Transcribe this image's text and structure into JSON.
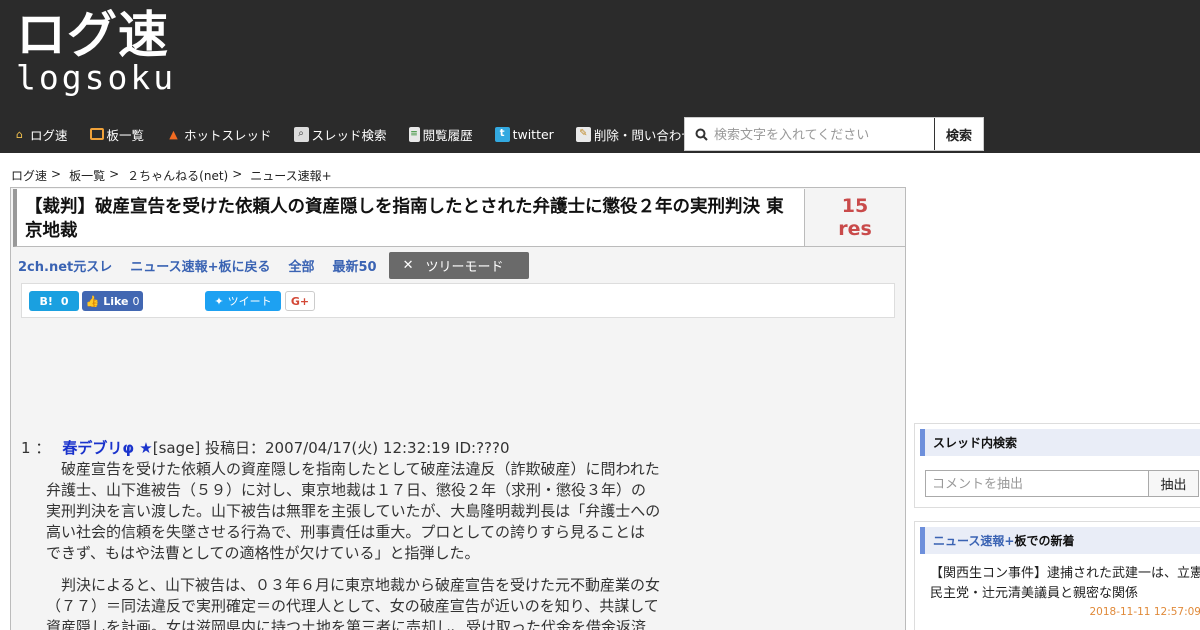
{
  "logo": {
    "jp": "ログ速",
    "en": "logsoku"
  },
  "nav": [
    {
      "label": "ログ速",
      "icon": "home-icon"
    },
    {
      "label": "板一覧",
      "icon": "board-icon"
    },
    {
      "label": "ホットスレッド",
      "icon": "fire-icon"
    },
    {
      "label": "スレッド検索",
      "icon": "thread-search-icon"
    },
    {
      "label": "閲覧履歴",
      "icon": "history-icon"
    },
    {
      "label": "twitter",
      "icon": "twitter-icon"
    },
    {
      "label": "削除・問い合わせ",
      "icon": "mail-icon"
    }
  ],
  "search": {
    "placeholder": "検索文字を入れてください",
    "button": "検索"
  },
  "breadcrumb": [
    "ログ速",
    "板一覧",
    "２ちゃんねる(net)",
    "ニュース速報+"
  ],
  "thread": {
    "title": "【裁判】破産宣告を受けた依頼人の資産隠しを指南したとされた弁護士に懲役２年の実刑判決 東京地裁",
    "res_count": "15",
    "res_label": "res"
  },
  "links": {
    "original": "2ch.net元スレ",
    "back": "ニュース速報+板に戻る",
    "all": "全部",
    "latest": "最新50",
    "tree_mode": "ツリーモード"
  },
  "share": {
    "hatena_count": "0",
    "fb_label": "Like",
    "fb_count": "0",
    "tweet_label": "ツイート",
    "gplus_label": "G+"
  },
  "post": {
    "number": "1",
    "colon": "：",
    "name": "春デブリφ ★",
    "meta": "[sage] 投稿日：2007/04/17(火) 12:32:19 ID:???0",
    "paragraphs": [
      [
        "　破産宣告を受けた依頼人の資産隠しを指南したとして破産法違反（詐欺破産）に問われた",
        "弁護士、山下進被告（５９）に対し、東京地裁は１７日、懲役２年（求刑・懲役３年）の",
        "実刑判決を言い渡した。山下被告は無罪を主張していたが、大島隆明裁判長は「弁護士への",
        "高い社会的信頼を失墜させる行為で、刑事責任は重大。プロとしての誇りすら見ることは",
        "できず、もはや法曹としての適格性が欠けている」と指弾した。"
      ],
      [
        "　判決によると、山下被告は、０３年６月に東京地裁から破産宣告を受けた元不動産業の女",
        "（７７）＝同法違反で実刑確定＝の代理人として、女の破産宣告が近いのを知り、共謀して",
        "資産隠しを計画。女は滋岡県内に持つ土地を第三者に売却し、受け取った代金を借金返済"
      ]
    ]
  },
  "sidebar": {
    "thread_search": {
      "title": "スレッド内検索",
      "placeholder": "コメントを抽出",
      "button": "抽出"
    },
    "new_posts": {
      "title_board": "ニュース速報+",
      "title_suffix": "板での新着",
      "items": [
        {
          "title": "【関西生コン事件】逮捕された武建一は、立憲民主党・辻元清美議員と親密な関係",
          "date": "2018-11-11 12:57:09"
        }
      ]
    }
  }
}
